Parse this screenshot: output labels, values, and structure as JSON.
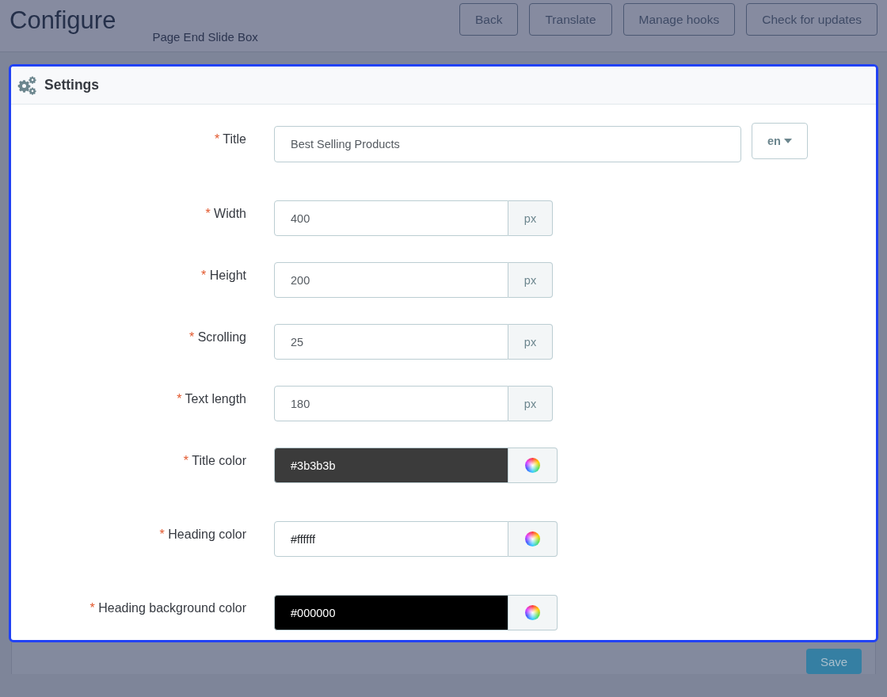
{
  "header": {
    "title": "Configure",
    "subtitle": "Page End Slide Box",
    "buttons": [
      "Back",
      "Translate",
      "Manage hooks",
      "Check for updates"
    ]
  },
  "panel": {
    "title": "Settings",
    "fields": [
      {
        "kind": "text",
        "required_mark": "*",
        "label": "Title",
        "value": "Best Selling Products",
        "language": "en"
      },
      {
        "kind": "number",
        "required_mark": "*",
        "label": "Width",
        "value": "400",
        "unit": "px"
      },
      {
        "kind": "number",
        "required_mark": "*",
        "label": "Height",
        "value": "200",
        "unit": "px"
      },
      {
        "kind": "number",
        "required_mark": "*",
        "label": "Scrolling",
        "value": "25",
        "unit": "px"
      },
      {
        "kind": "number",
        "required_mark": "*",
        "label": "Text length",
        "value": "180",
        "unit": "px"
      },
      {
        "kind": "color",
        "required_mark": "*",
        "label": "Title color",
        "value": "#3b3b3b",
        "color": "#3b3b3b"
      },
      {
        "kind": "color",
        "required_mark": "*",
        "label": "Heading color",
        "value": "#ffffff",
        "color": "#ffffff"
      },
      {
        "kind": "color",
        "required_mark": "*",
        "label": "Heading background color",
        "value": "#000000",
        "color": "#000000"
      }
    ]
  },
  "footer": {
    "save_button": "Save"
  }
}
